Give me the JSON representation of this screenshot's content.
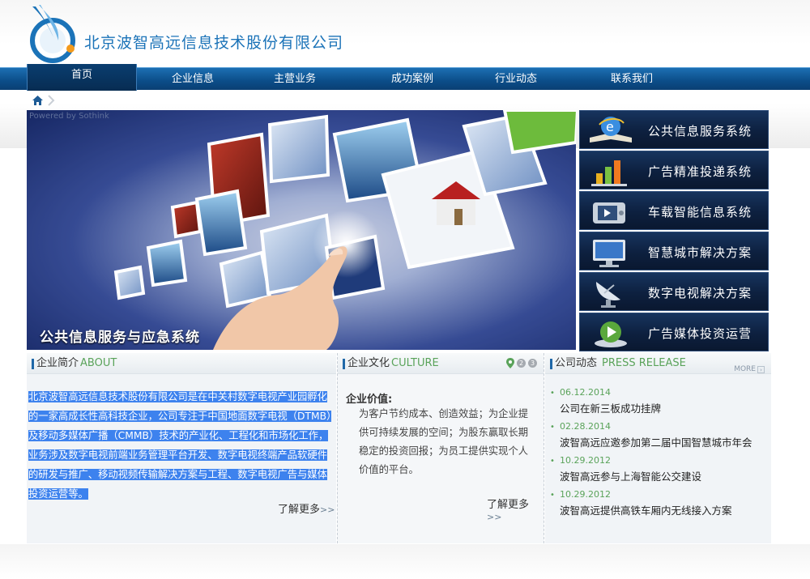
{
  "header": {
    "company_name": "北京波智高远信息技术股份有限公司"
  },
  "nav": {
    "items": [
      {
        "label": "首页",
        "active": true
      },
      {
        "label": "企业信息"
      },
      {
        "label": "主营业务"
      },
      {
        "label": "成功案例"
      },
      {
        "label": "行业动态"
      },
      {
        "label": "联系我们"
      }
    ]
  },
  "banner": {
    "powered_by": "Powered by Sothink",
    "caption": "公共信息服务与应急系统"
  },
  "side_menu": {
    "items": [
      {
        "label": "公共信息服务系统",
        "icon": "browser-book-icon"
      },
      {
        "label": "广告精准投递系统",
        "icon": "bar-chart-icon"
      },
      {
        "label": "车载智能信息系统",
        "icon": "media-device-icon"
      },
      {
        "label": "智慧城市解决方案",
        "icon": "monitor-icon"
      },
      {
        "label": "数字电视解决方案",
        "icon": "satellite-dish-icon"
      },
      {
        "label": "广告媒体投资运营",
        "icon": "play-button-icon"
      }
    ]
  },
  "about": {
    "title_zh": "企业简介",
    "title_en": "ABOUT",
    "text": "北京波智高远信息技术股份有限公司是在中关村数字电视产业园孵化的一家高成长性高科技企业，公司专注于中国地面数字电视（DTMB）及移动多媒体广播（CMMB）技术的产业化、工程化和市场化工作，业务涉及数字电视前端业务管理平台开发、数字电视终端产品软硬件的研发与推广、移动视频传输解决方案与工程、数字电视广告与媒体投资运营等。",
    "more": "了解更多",
    "more_arrows": ">>"
  },
  "culture": {
    "title_zh": "企业文化",
    "title_en": "CULTURE",
    "pages": [
      "2",
      "3"
    ],
    "value_title": "企业价值:",
    "value_text": "为客户节约成本、创造效益；为企业提供可持续发展的空间；为股东赢取长期稳定的投资回报；为员工提供实现个人价值的平台。",
    "more": "了解更多",
    "more_arrows": ">>"
  },
  "news": {
    "title_zh": "公司动态",
    "title_en": "PRESS RELEASE",
    "more_label": "MORE",
    "items": [
      {
        "date": "06.12.2014",
        "title": "公司在新三板成功挂牌"
      },
      {
        "date": "02.28.2014",
        "title": "波智高远应邀参加第二届中国智慧城市年会"
      },
      {
        "date": "10.29.2012",
        "title": "波智高远参与上海智能公交建设"
      },
      {
        "date": "10.29.2012",
        "title": "波智高远提供高铁车厢内无线接入方案"
      }
    ]
  },
  "colors": {
    "brand_blue": "#1b73b8",
    "nav_blue": "#0b4d88",
    "accent_green": "#5aa35a",
    "selection_blue": "#3d82ee"
  }
}
